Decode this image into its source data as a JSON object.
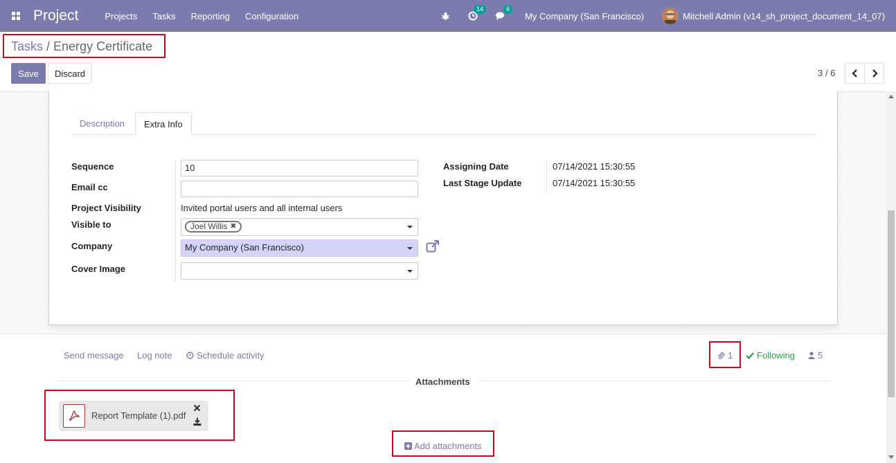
{
  "navbar": {
    "app_name": "Project",
    "menu": [
      "Projects",
      "Tasks",
      "Reporting",
      "Configuration"
    ],
    "activity_count": "14",
    "message_count": "6",
    "company": "My Company (San Francisco)",
    "user": "Mitchell Admin (v14_sh_project_document_14_07)"
  },
  "breadcrumb": {
    "parent": "Tasks",
    "separator": "/",
    "current": "Energy Certificate"
  },
  "buttons": {
    "save": "Save",
    "discard": "Discard"
  },
  "pager": {
    "text": "3 / 6"
  },
  "tabs": [
    "Description",
    "Extra Info"
  ],
  "fields": {
    "sequence": {
      "label": "Sequence",
      "value": "10"
    },
    "email_cc": {
      "label": "Email cc",
      "value": ""
    },
    "visibility": {
      "label": "Project Visibility",
      "value": "Invited portal users and all internal users"
    },
    "visible_to": {
      "label": "Visible to",
      "tag": "Joel Willis"
    },
    "company": {
      "label": "Company",
      "value": "My Company (San Francisco)"
    },
    "cover_image": {
      "label": "Cover Image",
      "value": ""
    },
    "assigning_date": {
      "label": "Assigning Date",
      "value": "07/14/2021 15:30:55"
    },
    "last_stage_update": {
      "label": "Last Stage Update",
      "value": "07/14/2021 15:30:55"
    }
  },
  "chatter": {
    "send_message": "Send message",
    "log_note": "Log note",
    "schedule_activity": "Schedule activity",
    "attachment_count": "1",
    "following": "Following",
    "followers_count": "5",
    "attachments_title": "Attachments",
    "attachment_name": "Report Template (1).pdf",
    "add_attachments": "Add attachments"
  },
  "colors": {
    "primary": "#7c7bad",
    "highlight": "#d0021b",
    "success": "#28a745",
    "company_field": "#d5d4f8"
  }
}
